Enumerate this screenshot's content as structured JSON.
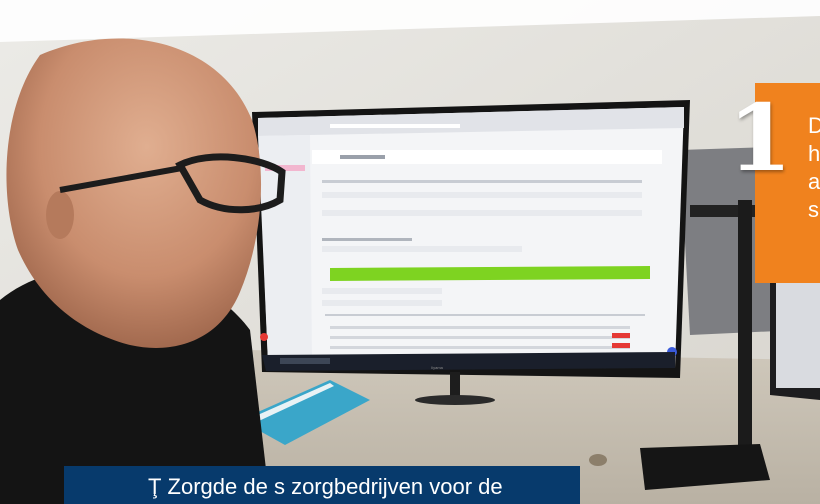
{
  "step": {
    "number": "1",
    "text": "D\nh\na\ns",
    "color": "#f0821e"
  },
  "caption": {
    "text": "Ţ Zorgde de s zorgbedrijven voor de",
    "background": "#073a6c"
  },
  "photo": {
    "monitor_brand": "Iiyama"
  },
  "colors": {
    "form_highlight": "#7ed321",
    "accent_orange": "#f0821e",
    "accent_navy": "#073a6c"
  }
}
